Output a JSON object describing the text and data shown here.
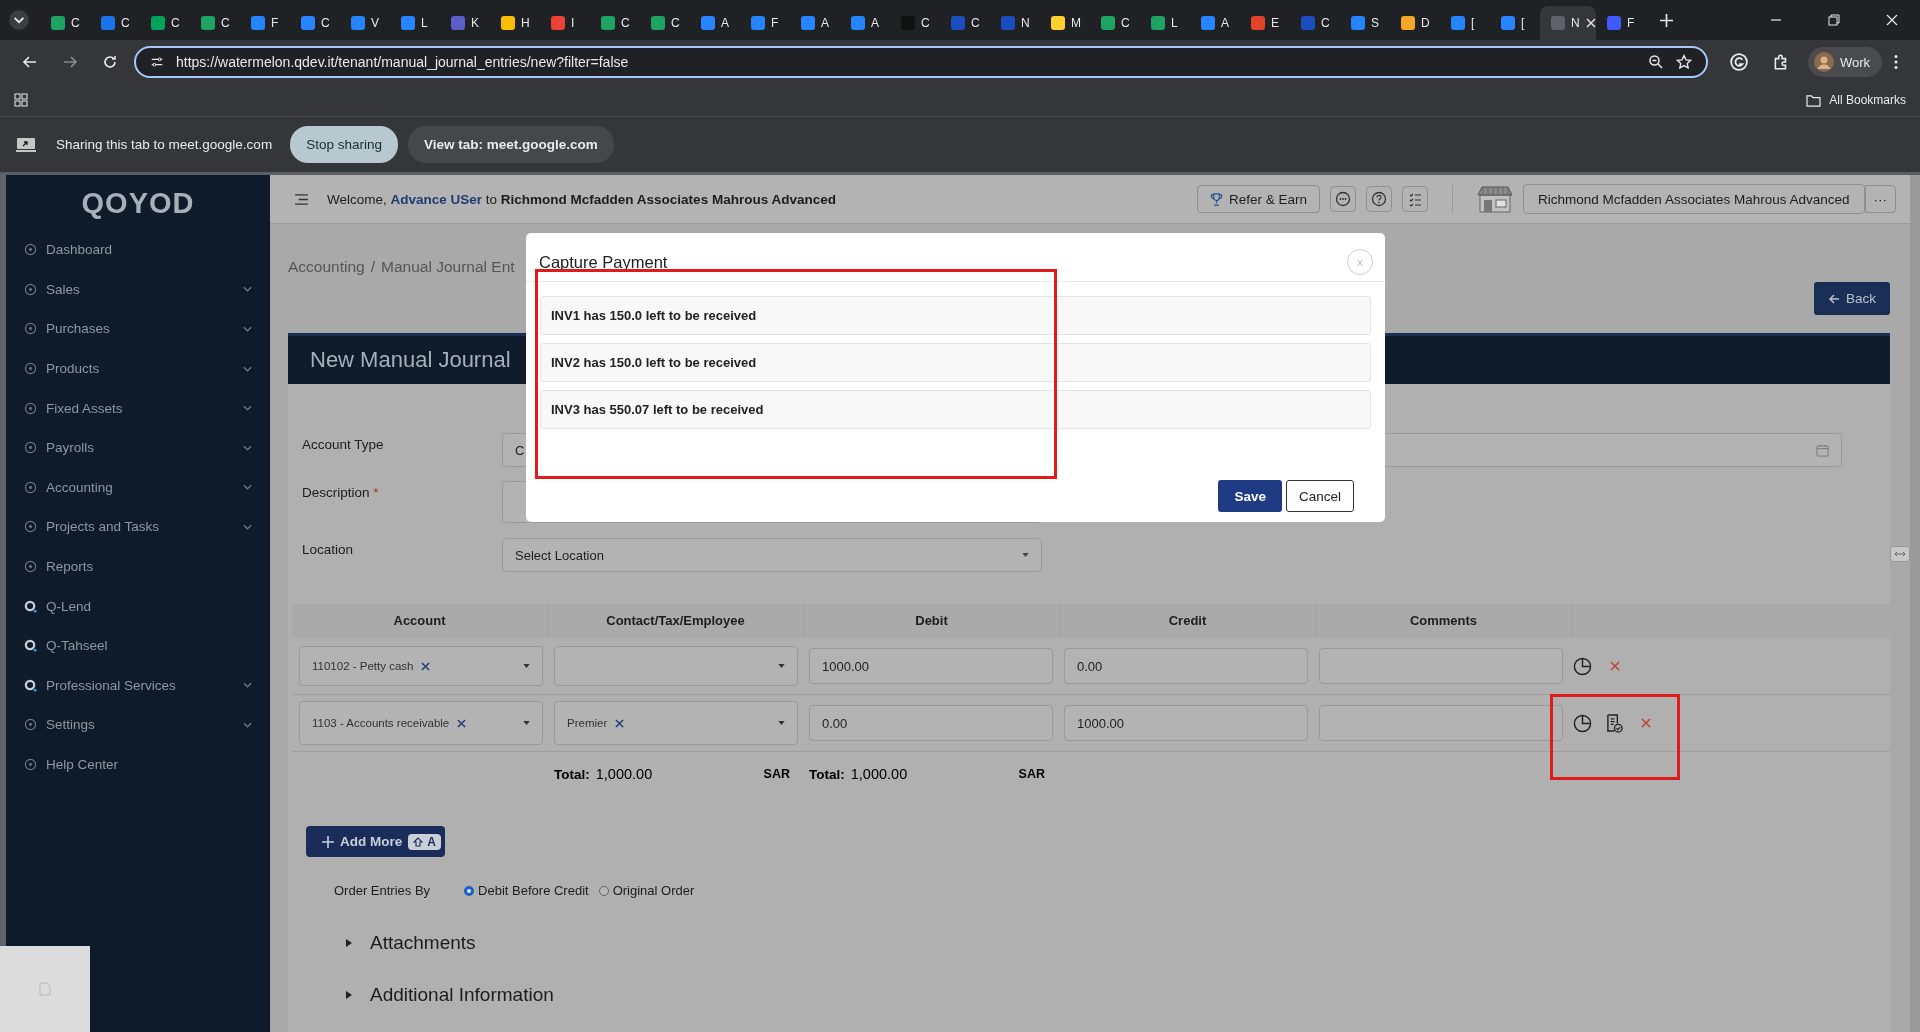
{
  "browser": {
    "tabs": [
      {
        "title": "C",
        "color": "#1ea362",
        "selected": false
      },
      {
        "title": "C",
        "color": "#1a73e8",
        "selected": false
      },
      {
        "title": "C",
        "color": "#00a35c",
        "selected": false
      },
      {
        "title": "C",
        "color": "#1ea362",
        "selected": false
      },
      {
        "title": "F",
        "color": "#2684ff",
        "selected": false
      },
      {
        "title": "C",
        "color": "#2684ff",
        "selected": false
      },
      {
        "title": "V",
        "color": "#2684ff",
        "selected": false
      },
      {
        "title": "L",
        "color": "#2684ff",
        "selected": false
      },
      {
        "title": "K",
        "color": "#5b5fc7",
        "selected": false
      },
      {
        "title": "H",
        "color": "#fbbc04",
        "selected": false
      },
      {
        "title": "I",
        "color": "#ea4335",
        "selected": false
      },
      {
        "title": "C",
        "color": "#1ea362",
        "selected": false
      },
      {
        "title": "C",
        "color": "#1ea362",
        "selected": false
      },
      {
        "title": "A",
        "color": "#2684ff",
        "selected": false
      },
      {
        "title": "F",
        "color": "#2684ff",
        "selected": false
      },
      {
        "title": "A",
        "color": "#2684ff",
        "selected": false
      },
      {
        "title": "A",
        "color": "#2684ff",
        "selected": false
      },
      {
        "title": "C",
        "color": "#111111",
        "selected": false
      },
      {
        "title": "C",
        "color": "#1a4dbf",
        "selected": false
      },
      {
        "title": "N",
        "color": "#1a4dbf",
        "selected": false
      },
      {
        "title": "M",
        "color": "#ffd02f",
        "selected": false
      },
      {
        "title": "C",
        "color": "#1ea362",
        "selected": false
      },
      {
        "title": "L",
        "color": "#1ea362",
        "selected": false
      },
      {
        "title": "A",
        "color": "#2684ff",
        "selected": false
      },
      {
        "title": "E",
        "color": "#e24329",
        "selected": false
      },
      {
        "title": "C",
        "color": "#1a4dbf",
        "selected": false
      },
      {
        "title": "S",
        "color": "#2684ff",
        "selected": false
      },
      {
        "title": "D",
        "color": "#f5a623",
        "selected": false
      },
      {
        "title": "[",
        "color": "#2684ff",
        "selected": false
      },
      {
        "title": "[",
        "color": "#2684ff",
        "selected": false
      },
      {
        "title": "N",
        "color": "#5f6368",
        "selected": true
      },
      {
        "title": "F",
        "color": "#3d5afe",
        "selected": false
      }
    ],
    "url": "https://watermelon.qdev.it/tenant/manual_journal_entries/new?filter=false",
    "profile": "Work",
    "bookmarks_label": "All Bookmarks"
  },
  "share_bar": {
    "message": "Sharing this tab to meet.google.com",
    "stop_button": "Stop sharing",
    "view_button": "View tab: meet.google.com"
  },
  "app": {
    "logo": "QOYOD",
    "sidebar": {
      "items": [
        {
          "label": "Dashboard",
          "kind": "page",
          "expandable": false
        },
        {
          "label": "Sales",
          "kind": "page",
          "expandable": true
        },
        {
          "label": "Purchases",
          "kind": "page",
          "expandable": true
        },
        {
          "label": "Products",
          "kind": "page",
          "expandable": true
        },
        {
          "label": "Fixed Assets",
          "kind": "page",
          "expandable": true
        },
        {
          "label": "Payrolls",
          "kind": "page",
          "expandable": true
        },
        {
          "label": "Accounting",
          "kind": "page",
          "expandable": true
        },
        {
          "label": "Projects and Tasks",
          "kind": "page",
          "expandable": true
        },
        {
          "label": "Reports",
          "kind": "page",
          "expandable": false
        },
        {
          "label": "Q-Lend",
          "kind": "q-app",
          "expandable": false
        },
        {
          "label": "Q-Tahseel",
          "kind": "q-app",
          "expandable": false
        },
        {
          "label": "Professional Services",
          "kind": "q-app",
          "expandable": true
        },
        {
          "label": "Settings",
          "kind": "page",
          "expandable": true
        },
        {
          "label": "Help Center",
          "kind": "page",
          "expandable": false
        }
      ]
    },
    "header": {
      "welcome": "Welcome,",
      "user": "Advance USer",
      "joiner": "to",
      "company": "Richmond Mcfadden Associates Mahrous Advanced",
      "refer_button": "Refer & Earn",
      "company_button": "Richmond Mcfadden Associates Mahrous Advanced",
      "more_button": "···"
    },
    "breadcrumb": {
      "separator": "/",
      "items": [
        {
          "label": "Accounting"
        },
        {
          "label": "Manual Journal Ent"
        }
      ]
    },
    "back_button": "Back",
    "panel_title": "New Manual Journal",
    "form": {
      "account_type": {
        "label": "Account Type",
        "value": "C"
      },
      "description": {
        "label": "Description",
        "required": true,
        "required_mark": "*"
      },
      "location": {
        "label": "Location",
        "placeholder": "Select Location"
      }
    },
    "table": {
      "columns": [
        "Account",
        "Contact/Tax/Employee",
        "Debit",
        "Credit",
        "Comments"
      ],
      "rows": [
        {
          "account": "110102 - Petty cash",
          "contact": "",
          "debit": "1000.00",
          "credit": "0.00",
          "comments": "",
          "has_payment": false
        },
        {
          "account": "1103 - Accounts receivable",
          "contact": "Premier",
          "debit": "0.00",
          "credit": "1000.00",
          "comments": "",
          "has_payment": true
        }
      ],
      "totals": [
        {
          "label": "Total:",
          "value": "1,000.00",
          "currency": "SAR"
        },
        {
          "label": "Total:",
          "value": "1,000.00",
          "currency": "SAR"
        }
      ]
    },
    "add_more": {
      "label": "Add More",
      "shortcut": "A"
    },
    "order": {
      "label": "Order Entries By",
      "options": [
        {
          "label": "Debit Before Credit",
          "selected": true
        },
        {
          "label": "Original Order",
          "selected": false
        }
      ]
    },
    "sections": [
      {
        "title": "Attachments",
        "expanded": false
      },
      {
        "title": "Additional Information",
        "expanded": false
      }
    ]
  },
  "modal": {
    "title": "Capture Payment",
    "close": "x",
    "items": [
      "INV1 has 150.0 left to be received",
      "INV2 has 150.0 left to be received",
      "INV3 has 550.07 left to be received"
    ],
    "save_button": "Save",
    "cancel_button": "Cancel"
  }
}
